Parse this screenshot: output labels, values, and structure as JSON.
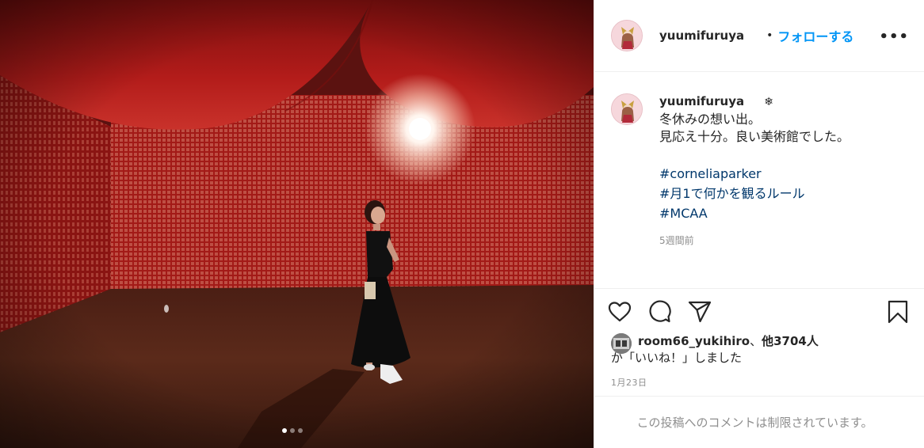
{
  "post": {
    "media": {
      "carousel": {
        "count": 3,
        "active_index": 0
      }
    },
    "header": {
      "username": "yuumifuruya",
      "separator": "•",
      "follow_label": "フォローする",
      "more_icon": "more-horizontal-icon",
      "more_label": "•••"
    },
    "caption": {
      "username": "yuumifuruya",
      "emoji": "❄",
      "lines": [
        "冬休みの想い出。",
        "見応え十分。良い美術館でした。"
      ],
      "hashtags": [
        "#corneliaparker",
        "#月1で何かを観るルール",
        "#MCAA"
      ],
      "time_ago": "5週間前"
    },
    "actions": {
      "like_icon": "heart-icon",
      "comment_icon": "comment-icon",
      "share_icon": "paper-plane-icon",
      "save_icon": "bookmark-icon"
    },
    "likes": {
      "user": "room66_yukihiro",
      "joiner": "、",
      "others": "他3704人",
      "suffix": "が「いいね！」しました"
    },
    "date": "1月23日",
    "comments_restricted": "この投稿へのコメントは制限されています。",
    "colors": {
      "accent": "#0095f6",
      "hashtag": "#00376b",
      "muted": "#8e8e8e",
      "photo_red": "#b01e1c"
    }
  }
}
